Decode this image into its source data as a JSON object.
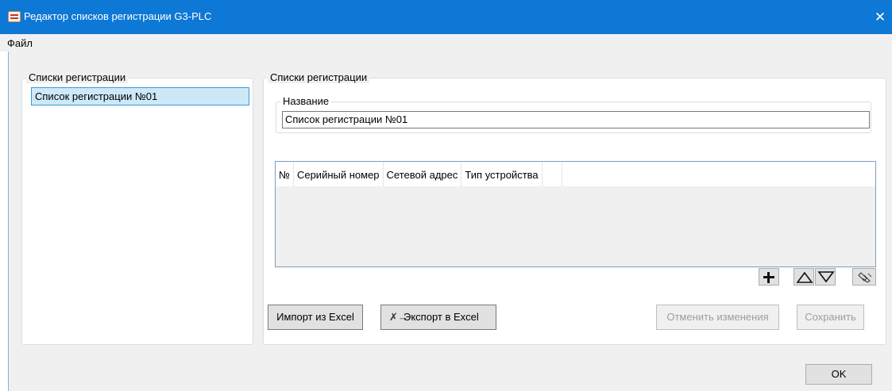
{
  "window": {
    "title": "Редактор списков регистрации G3-PLC",
    "app_icon": "list-editor-icon",
    "close_glyph": "✕",
    "accent_color": "#0e78d6"
  },
  "menu": {
    "file_label": "Файл"
  },
  "lists_panel": {
    "title": "Списки регистрации",
    "items": [
      {
        "label": "Список регистрации №01",
        "selected": true
      }
    ]
  },
  "editor_panel": {
    "title": "Списки регистрации",
    "name_label": "Название",
    "name_value": "Список регистрации №01",
    "table": {
      "columns": [
        "№",
        "Серийный номер",
        "Сетевой адрес",
        "Тип устройства"
      ],
      "rows": []
    },
    "icon_buttons": {
      "add": "plus-icon",
      "move_up": "triangle-up-icon",
      "move_down": "triangle-down-icon",
      "clear": "eraser-icon"
    },
    "import_label": "Импорт из Excel",
    "export_label": "Экспорт в Excel",
    "export_icon": "excel-export-icon",
    "cancel_label": "Отменить изменения",
    "save_label": "Сохранить"
  },
  "footer": {
    "ok_label": "OK"
  }
}
